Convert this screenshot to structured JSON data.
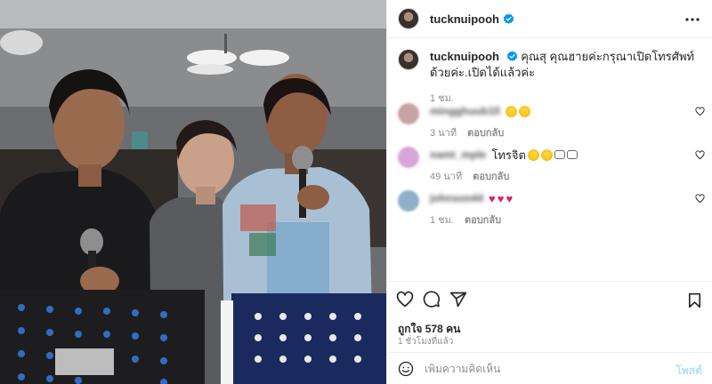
{
  "post": {
    "username": "tucknuipooh",
    "verified_icon": "verified-badge-icon",
    "more_icon": "more-horizontal-icon"
  },
  "caption": {
    "username": "tucknuipooh",
    "text": "คุณสุ คุณฮายค่ะกรุณาเปิดโทรศัพท์ด้วยค่ะ.เปิดได้แล้วค่ะ",
    "time": "1 ชม."
  },
  "comments": [
    {
      "username": "mingghuub1ll",
      "text": "",
      "emojis": [
        "laugh",
        "heart-eyes"
      ],
      "time": "3 นาที",
      "reply": "ตอบกลับ",
      "avatar_color": "#c7a4a4"
    },
    {
      "username": "namt_mple",
      "text": "โทรจิต",
      "emojis": [
        "laugh",
        "laugh",
        "hand",
        "hand"
      ],
      "time": "49 นาที",
      "reply": "ตอบกลับ",
      "avatar_color": "#d8a6d6"
    },
    {
      "username": "johnson44",
      "text": "",
      "emojis": [
        "red-heart",
        "red-heart",
        "red-heart"
      ],
      "time": "1 ชม.",
      "reply": "ตอบกลับ",
      "avatar_color": "#8fb0c8"
    }
  ],
  "actions": {
    "like_icon": "heart-icon",
    "comment_icon": "comment-icon",
    "share_icon": "share-icon",
    "save_icon": "bookmark-icon",
    "likes": "ถูกใจ 578 คน",
    "posted": "1 ชั่วโมงที่แล้ว"
  },
  "add_comment": {
    "emoji_icon": "smiley-icon",
    "placeholder": "เพิ่มความคิดเห็น",
    "post_label": "โพสต์"
  },
  "colors": {
    "accent": "#0095f6",
    "post_disabled": "#b2dffc",
    "verified": "#0095f6"
  }
}
